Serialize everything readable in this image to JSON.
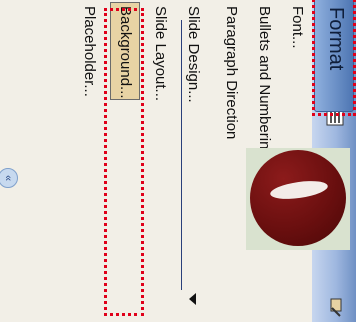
{
  "format_tab": {
    "label": "Format"
  },
  "menu": {
    "items": [
      {
        "label": "Font..."
      },
      {
        "label": "Bullets and Numbering..."
      },
      {
        "label": "Paragraph Direction"
      },
      {
        "label": "Slide Design..."
      },
      {
        "label": "Slide Layout..."
      },
      {
        "label": "Background..."
      },
      {
        "label": "Placeholder..."
      }
    ],
    "highlighted_index": 5
  },
  "collapse_button": {
    "label": "«"
  },
  "colors": {
    "header_gradient_top": "#6f90c4",
    "menu_background": "#f2efe7",
    "highlight": "#e8d3a4",
    "annotation_dotted_border": "#e0001a",
    "logo_red": "#6a0f0f"
  },
  "icons": [
    "font-icon",
    "bullets-icon",
    "slide-layout-icon",
    "slide-design-icon",
    "background-icon",
    "dropdown-arrow-icon",
    "collapse-left-icon"
  ]
}
